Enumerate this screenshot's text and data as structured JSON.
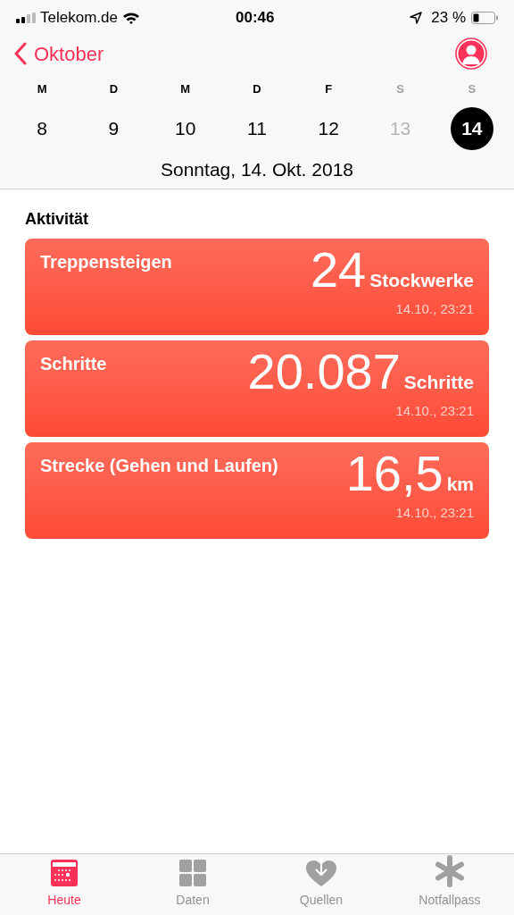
{
  "status_bar": {
    "carrier": "Telekom.de",
    "time": "00:46",
    "battery": "23 %"
  },
  "nav": {
    "back": "Oktober"
  },
  "week": [
    {
      "weekday": "M",
      "day": "8",
      "weekend": false,
      "dimmed": false,
      "selected": false
    },
    {
      "weekday": "D",
      "day": "9",
      "weekend": false,
      "dimmed": false,
      "selected": false
    },
    {
      "weekday": "M",
      "day": "10",
      "weekend": false,
      "dimmed": false,
      "selected": false
    },
    {
      "weekday": "D",
      "day": "11",
      "weekend": false,
      "dimmed": false,
      "selected": false
    },
    {
      "weekday": "F",
      "day": "12",
      "weekend": false,
      "dimmed": false,
      "selected": false
    },
    {
      "weekday": "S",
      "day": "13",
      "weekend": true,
      "dimmed": true,
      "selected": false
    },
    {
      "weekday": "S",
      "day": "14",
      "weekend": true,
      "dimmed": false,
      "selected": true
    }
  ],
  "date_label": "Sonntag, 14. Okt. 2018",
  "section_title": "Aktivität",
  "cards": [
    {
      "title": "Treppensteigen",
      "value": "24",
      "unit": "Stockwerke",
      "time": "14.10., 23:21"
    },
    {
      "title": "Schritte",
      "value": "20.087",
      "unit": "Schritte",
      "time": "14.10., 23:21"
    },
    {
      "title": "Strecke (Gehen und Laufen)",
      "value": "16,5",
      "unit": "km",
      "time": "14.10., 23:21"
    }
  ],
  "tabs": [
    {
      "label": "Heute",
      "kind": "today",
      "selected": true
    },
    {
      "label": "Daten",
      "kind": "data",
      "selected": false
    },
    {
      "label": "Quellen",
      "kind": "sources",
      "selected": false
    },
    {
      "label": "Notfallpass",
      "kind": "emergency",
      "selected": false
    }
  ]
}
